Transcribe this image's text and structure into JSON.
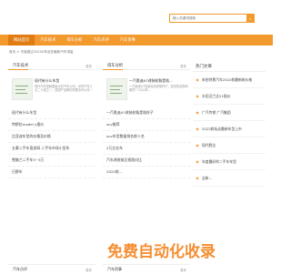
{
  "search": {
    "placeholder": "输入关键词搜索",
    "button_icon": "search-icon"
  },
  "nav": {
    "items": [
      {
        "label": "网站首页",
        "active": true
      },
      {
        "label": "汽车技术",
        "active": false
      },
      {
        "label": "排车分析",
        "active": false
      },
      {
        "label": "汽车点评",
        "active": false
      },
      {
        "label": "汽车资事",
        "active": false
      }
    ]
  },
  "breadcrumb": "首页 > 不能错过20200年这些最新汽车排量",
  "left_column": {
    "title": "汽车技术",
    "more": "更多",
    "feature": {
      "title": "现代有什么车型",
      "desc": "现代汽车是韩国最大的汽车公司，世界汽车工业二十强之一，是国产品牌的重要合作伙伴..."
    },
    "items": [
      "现代有什么车型",
      "特斯拉model y报价",
      "比亚迪车型的价格及价格",
      "五菱二手车直卖网 二手车市场小型车",
      "雪佛兰二手车3~5万",
      "日野车"
    ]
  },
  "right_column": {
    "title": "排车分析",
    "more": "更多",
    "feature": {
      "title": "一汽奥迪A7改装轮毂是啥...",
      "desc": "一汽奥迪A7改装轮毂是啥样子，轮毂的选择有哪些？2020年..."
    },
    "items": [
      "一汽奥迪A7改装轮毂是啥样子",
      "suv推荐",
      "suv车型数量排名前十名",
      "2万左右车",
      "汽车改装前后视频对比",
      "2022款..."
    ]
  },
  "sidebar": {
    "title": "热门文章",
    "items": [
      "宋伯特黑汽车2022款最新款价格",
      "丰田汉兰达21报价",
      "广汽传祺 广汽集团",
      "2022款标志最新车型上市",
      "现代胜达",
      "年度最好的二手车车型",
      "全新..."
    ]
  },
  "bottom_tabs": [
    {
      "title": "汽车点评",
      "more": "更多"
    },
    {
      "title": "汽车资事",
      "more": "更多"
    }
  ],
  "watermark": "免费自动化收录"
}
